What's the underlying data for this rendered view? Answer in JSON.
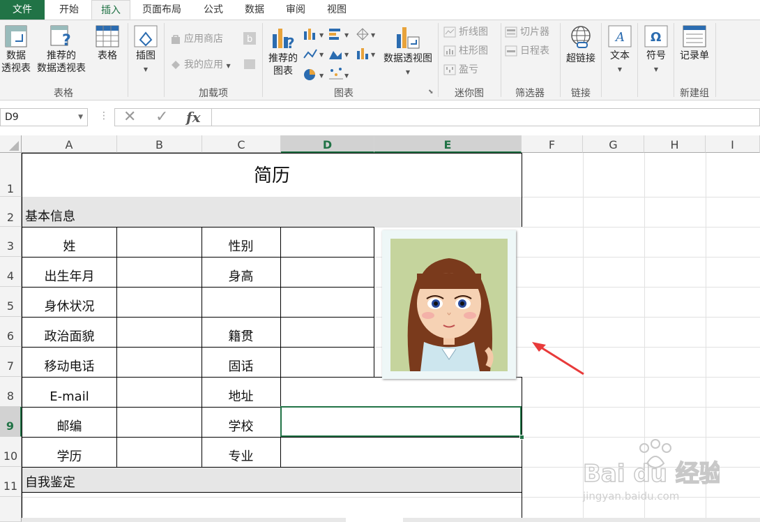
{
  "ribbon_tabs": [
    "文件",
    "开始",
    "插入",
    "页面布局",
    "公式",
    "数据",
    "审阅",
    "视图"
  ],
  "ribbon": {
    "groups": {
      "tables": "表格",
      "addins": "加载项",
      "charts": "图表",
      "sparklines": "迷你图",
      "filters": "筛选器",
      "links": "链接",
      "newgroup": "新建组"
    },
    "pivot_table": "数据\n透视表",
    "recommended_pivot": "推荐的\n数据透视表",
    "table": "表格",
    "illustrations": "插图",
    "app_store": "应用商店",
    "my_apps": "我的应用",
    "recommended_charts": "推荐的\n图表",
    "pivot_chart": "数据透视图",
    "spark_line": "折线图",
    "spark_column": "柱形图",
    "spark_winloss": "盈亏",
    "slicer": "切片器",
    "timeline": "日程表",
    "hyperlink": "超链接",
    "text": "文本",
    "symbols": "符号",
    "form": "记录单"
  },
  "formula_bar": {
    "name_box": "D9",
    "fx": "fx",
    "formula": ""
  },
  "columns": [
    "A",
    "B",
    "C",
    "D",
    "E",
    "F",
    "G",
    "H",
    "I"
  ],
  "rows": [
    "1",
    "2",
    "3",
    "4",
    "5",
    "6",
    "7",
    "8",
    "9",
    "10",
    "11"
  ],
  "selected": {
    "column": "D",
    "row": "9"
  },
  "sheet": {
    "title": "简历",
    "section_basic": "基本信息",
    "section_self": "自我鉴定",
    "labels_a": [
      "姓",
      "出生年月",
      "身休状况",
      "政治面貌",
      "移动电话",
      "E-mail",
      "邮编",
      "学历"
    ],
    "labels_c": [
      "性别",
      "身高",
      "",
      "籍贯",
      "固话",
      "地址",
      "学校",
      "专业"
    ]
  },
  "watermark": {
    "brand": "Bai du 经验",
    "url": "jingyan.baidu.com"
  },
  "colors": {
    "excel_green": "#217346",
    "arrow": "#e83a3a"
  }
}
